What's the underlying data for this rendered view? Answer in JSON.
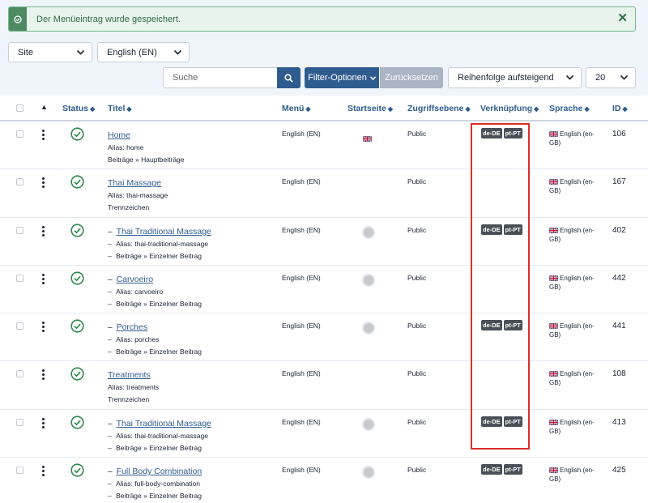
{
  "alert": {
    "message": "Der Menüeintrag wurde gespeichert.",
    "close": "✕"
  },
  "filters": {
    "site": "Site",
    "language": "English (EN)",
    "search_placeholder": "Suche",
    "filter_options": "Filter-Optionen",
    "reset": "Zurücksetzen",
    "ordering": "Reihenfolge aufsteigend",
    "limit": "20"
  },
  "columns": {
    "status": "Status",
    "title": "Titel",
    "menu": "Menü",
    "home": "Startseite",
    "access": "Zugriffsebene",
    "association": "Verknüpfung",
    "language": "Sprache",
    "id": "ID"
  },
  "rows": [
    {
      "title": "Home",
      "child": false,
      "alias": "Alias: home",
      "type": "Beiträge » Hauptbeiträge",
      "menu": "English (EN)",
      "home": "flag",
      "access": "Public",
      "assoc": [
        "de-DE",
        "pt-PT"
      ],
      "language": "English (en-GB)",
      "id": "106"
    },
    {
      "title": "Thai Massage",
      "child": false,
      "alias": "Alias: thai-massage",
      "type": "Trennzeichen",
      "menu": "English (EN)",
      "home": "none",
      "access": "Public",
      "assoc": [],
      "language": "English (en-GB)",
      "id": "167"
    },
    {
      "title": "Thai Traditional Massage",
      "child": true,
      "alias": "Alias: thai-traditional-massage",
      "type": "Beiträge » Einzelner Beitrag",
      "menu": "English (EN)",
      "home": "dot",
      "access": "Public",
      "assoc": [
        "de-DE",
        "pt-PT"
      ],
      "language": "English (en-GB)",
      "id": "402"
    },
    {
      "title": "Carvoeiro",
      "child": true,
      "alias": "Alias: carvoeiro",
      "type": "Beiträge » Einzelner Beitrag",
      "menu": "English (EN)",
      "home": "dot",
      "access": "Public",
      "assoc": [],
      "language": "English (en-GB)",
      "id": "442"
    },
    {
      "title": "Porches",
      "child": true,
      "alias": "Alias: porches",
      "type": "Beiträge » Einzelner Beitrag",
      "menu": "English (EN)",
      "home": "dot",
      "access": "Public",
      "assoc": [
        "de-DE",
        "pt-PT"
      ],
      "language": "English (en-GB)",
      "id": "441"
    },
    {
      "title": "Treatments",
      "child": false,
      "alias": "Alias: treatments",
      "type": "Trennzeichen",
      "menu": "English (EN)",
      "home": "none",
      "access": "Public",
      "assoc": [],
      "language": "English (en-GB)",
      "id": "108"
    },
    {
      "title": "Thai Traditional Massage",
      "child": true,
      "alias": "Alias: thai-traditional-massage",
      "type": "Beiträge » Einzelner Beitrag",
      "menu": "English (EN)",
      "home": "dot",
      "access": "Public",
      "assoc": [
        "de-DE",
        "pt-PT"
      ],
      "language": "English (en-GB)",
      "id": "413"
    },
    {
      "title": "Full Body Combination",
      "child": true,
      "alias": "Alias: full-body-combination",
      "type": "Beiträge » Einzelner Beitrag",
      "menu": "English (EN)",
      "home": "dot",
      "access": "Public",
      "assoc": [
        "de-DE",
        "pt-PT"
      ],
      "language": "English (en-GB)",
      "id": "425"
    }
  ],
  "colors": {
    "primary": "#2f5c8f",
    "success": "#2f8a4f",
    "highlight": "#d9302c",
    "badge": "#495057"
  }
}
